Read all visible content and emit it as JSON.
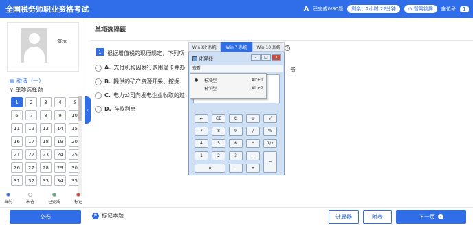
{
  "header": {
    "title": "全国税务师职业资格考试",
    "font_label": "A",
    "done_text": "已完成0/80题",
    "time_left": "剩余：2小时 22分钟",
    "hide_time_label": "暂离锁屏",
    "seat_label": "座位号",
    "seat_number": "1"
  },
  "sidebar": {
    "candidate_name": "演示",
    "section_title": "税法（一）",
    "subsection_title": "单项选择题",
    "questions": [
      "1",
      "2",
      "3",
      "4",
      "5",
      "6",
      "7",
      "8",
      "9",
      "10",
      "11",
      "12",
      "13",
      "14",
      "15",
      "16",
      "17",
      "18",
      "19",
      "20",
      "21",
      "22",
      "23",
      "24",
      "25",
      "26",
      "27",
      "28",
      "29",
      "30",
      "31",
      "32",
      "33",
      "34",
      "35"
    ],
    "current_question": "1",
    "legend": [
      {
        "label": "当前",
        "color": "#2f6ee8"
      },
      {
        "label": "未答",
        "color": "#ffffff"
      },
      {
        "label": "已完成",
        "color": "#4cb86b"
      },
      {
        "label": "标记",
        "color": "#e23b3b"
      }
    ]
  },
  "question": {
    "type": "单项选择题",
    "number": "1",
    "text": "根据增值税的现行规定，下列项",
    "text_tail": "费",
    "options": [
      {
        "letter": "A.",
        "text": "支付机构因发行多用途卡并办"
      },
      {
        "letter": "B.",
        "text": "提供的矿产资源开采、挖掘、"
      },
      {
        "letter": "C.",
        "text": "电力公司向发电企业收取的过"
      },
      {
        "letter": "D.",
        "text": "存款利息"
      }
    ]
  },
  "calculator": {
    "tabs": [
      "Win XP 系统",
      "Win 7 系统",
      "Win 10 系统"
    ],
    "active_tab": "Win 7 系统",
    "title": "计算器",
    "minimize": "–",
    "maximize": "□",
    "close": "×",
    "menu": "查看",
    "view_menu": [
      {
        "bullet": "●",
        "label": "标准型",
        "shortcut": "Alt+1"
      },
      {
        "bullet": "",
        "label": "科学型",
        "shortcut": "Alt+2"
      }
    ],
    "keys": [
      "←",
      "CE",
      "C",
      "±",
      "√",
      "7",
      "8",
      "9",
      "/",
      "%",
      "4",
      "5",
      "6",
      "*",
      "1/x",
      "1",
      "2",
      "3",
      "-",
      "=",
      "0",
      ".",
      "+"
    ]
  },
  "footer": {
    "submit_label": "交卷",
    "mark_label": "标记本题",
    "calculator_label": "计算器",
    "appendix_label": "附表",
    "next_label": "下一页"
  }
}
